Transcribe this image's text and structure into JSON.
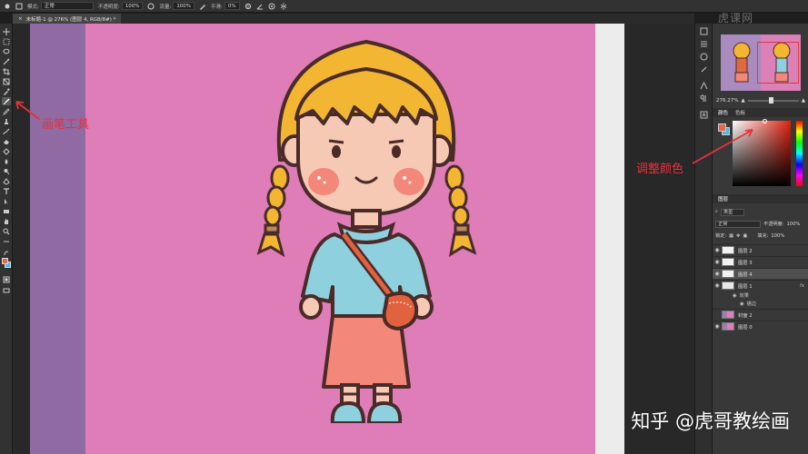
{
  "options_bar": {
    "mode_label": "模式:",
    "mode_value": "正常",
    "opacity_label": "不透明度:",
    "opacity_value": "100%",
    "flow_label": "流量:",
    "flow_value": "100%",
    "smooth_label": "平滑:",
    "smooth_value": "0%"
  },
  "document": {
    "tab_title": "未标题-1 @ 276% (图层 4, RGB/8#) *"
  },
  "annotations": {
    "brush_tool_label": "画笔工具",
    "adjust_color_label": "调整颜色",
    "color": "#e8313a"
  },
  "navigator": {
    "zoom_value": "276.27%"
  },
  "color_panel": {
    "tab_color": "颜色",
    "tab_swatches": "色板",
    "foreground": "#e8654a",
    "background": "#4db8e0"
  },
  "layers_panel": {
    "tab_layers": "图层",
    "filter_kind": "类型",
    "blend_mode": "正常",
    "opacity_label": "不透明度:",
    "opacity_value": "100%",
    "lock_label": "锁定:",
    "fill_label": "填充:",
    "fill_value": "100%",
    "layers": [
      {
        "name": "图层 2"
      },
      {
        "name": "图层 3"
      },
      {
        "name": "图层 4"
      },
      {
        "name": "图层 1"
      },
      {
        "name": "图层 0"
      }
    ],
    "effects_label": "效果",
    "stroke_label": "描边",
    "group_name": "封面 2"
  },
  "watermark": {
    "bottom_text": "知乎 @虎哥教绘画",
    "top_text": "虎课网"
  },
  "canvas_colors": {
    "background": "#de7db8",
    "left_band": "#8f6aa3",
    "right_band": "#ececec"
  }
}
